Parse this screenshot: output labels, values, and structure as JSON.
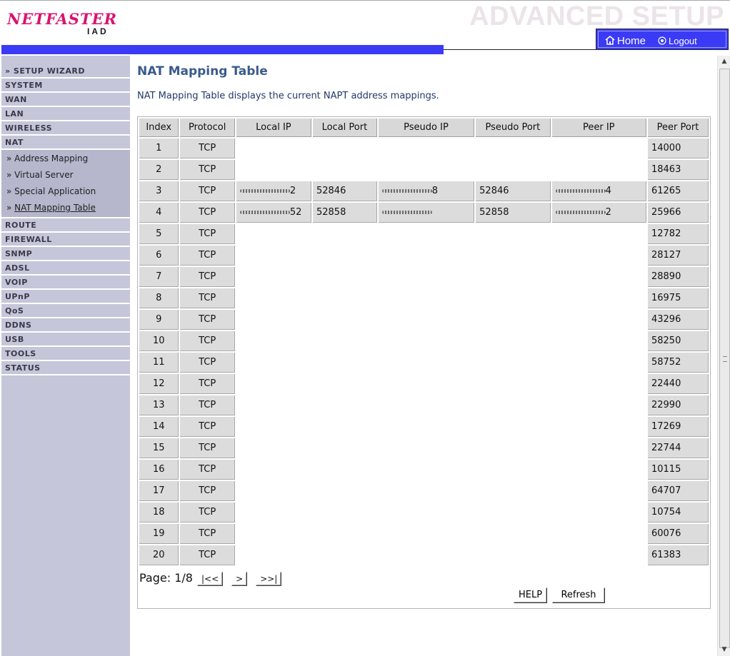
{
  "header": {
    "brand": "NETFASTER",
    "brand_sub": "IAD",
    "banner_title": "ADVANCED SETUP",
    "home_label": "Home",
    "logout_label": "Logout",
    "accent_color": "#3b3bf6"
  },
  "sidebar": {
    "items": [
      {
        "label": "» SETUP WIZARD"
      },
      {
        "label": "SYSTEM"
      },
      {
        "label": "WAN"
      },
      {
        "label": "LAN"
      },
      {
        "label": "WIRELESS"
      },
      {
        "label": "NAT"
      }
    ],
    "nat_sub": [
      {
        "label": "» Address Mapping"
      },
      {
        "label": "» Virtual Server"
      },
      {
        "label": "» Special Application"
      },
      {
        "label": "» ",
        "active_label": "NAT Mapping Table"
      }
    ],
    "items_after": [
      {
        "label": "ROUTE"
      },
      {
        "label": "FIREWALL"
      },
      {
        "label": "SNMP"
      },
      {
        "label": "ADSL"
      },
      {
        "label": "VOIP"
      },
      {
        "label": "UPnP"
      },
      {
        "label": "QoS"
      },
      {
        "label": "DDNS"
      },
      {
        "label": "USB"
      },
      {
        "label": "TOOLS"
      },
      {
        "label": "STATUS"
      }
    ]
  },
  "main": {
    "title": "NAT Mapping Table",
    "description": "NAT Mapping Table displays the current NAPT address mappings.",
    "columns": [
      "Index",
      "Protocol",
      "Local IP",
      "Local Port",
      "Pseudo IP",
      "Pseudo Port",
      "Peer IP",
      "Peer Port"
    ],
    "rows": [
      {
        "index": "1",
        "protocol": "TCP",
        "peer_port": "14000"
      },
      {
        "index": "2",
        "protocol": "TCP",
        "peer_port": "18463"
      },
      {
        "index": "3",
        "protocol": "TCP",
        "local_ip_tail": "2",
        "local_port": "52846",
        "pseudo_ip_tail": "8",
        "pseudo_port": "52846",
        "peer_ip_tail": "4",
        "peer_port": "61265"
      },
      {
        "index": "4",
        "protocol": "TCP",
        "local_ip_tail": "52",
        "local_port": "52858",
        "pseudo_ip_tail": "",
        "pseudo_port": "52858",
        "peer_ip_tail": "2",
        "peer_port": "25966"
      },
      {
        "index": "5",
        "protocol": "TCP",
        "peer_port": "12782"
      },
      {
        "index": "6",
        "protocol": "TCP",
        "peer_port": "28127"
      },
      {
        "index": "7",
        "protocol": "TCP",
        "peer_port": "28890"
      },
      {
        "index": "8",
        "protocol": "TCP",
        "peer_port": "16975"
      },
      {
        "index": "9",
        "protocol": "TCP",
        "peer_port": "43296"
      },
      {
        "index": "10",
        "protocol": "TCP",
        "peer_port": "58250"
      },
      {
        "index": "11",
        "protocol": "TCP",
        "peer_port": "58752"
      },
      {
        "index": "12",
        "protocol": "TCP",
        "peer_port": "22440"
      },
      {
        "index": "13",
        "protocol": "TCP",
        "peer_port": "22990"
      },
      {
        "index": "14",
        "protocol": "TCP",
        "peer_port": "17269"
      },
      {
        "index": "15",
        "protocol": "TCP",
        "peer_port": "22744"
      },
      {
        "index": "16",
        "protocol": "TCP",
        "peer_port": "10115"
      },
      {
        "index": "17",
        "protocol": "TCP",
        "peer_port": "64707"
      },
      {
        "index": "18",
        "protocol": "TCP",
        "peer_port": "10754"
      },
      {
        "index": "19",
        "protocol": "TCP",
        "peer_port": "60076"
      },
      {
        "index": "20",
        "protocol": "TCP",
        "peer_port": "61383"
      }
    ],
    "pager": {
      "label": "Page: 1/8",
      "first": "|<<",
      "next": ">",
      "last": ">>|"
    },
    "help_label": "HELP",
    "refresh_label": "Refresh"
  }
}
